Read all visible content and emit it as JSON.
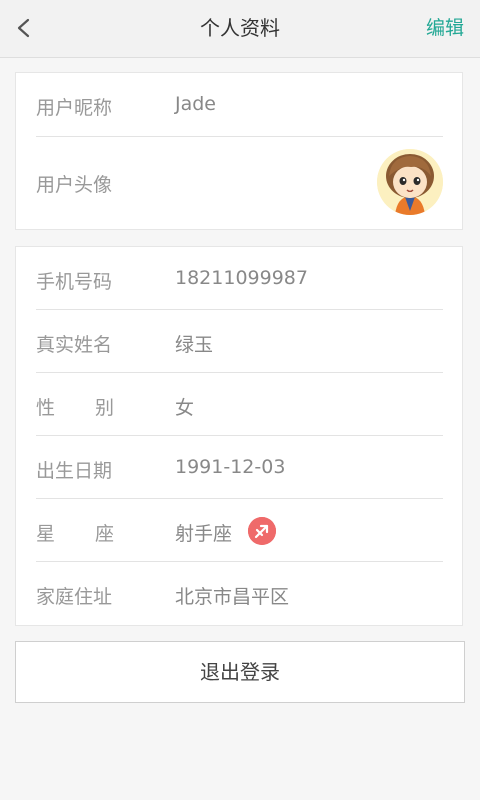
{
  "header": {
    "title": "个人资料",
    "edit_label": "编辑"
  },
  "profile": {
    "nickname_label": "用户昵称",
    "nickname_value": "Jade",
    "avatar_label": "用户头像"
  },
  "details": {
    "phone_label": "手机号码",
    "phone_value": "18211099987",
    "realname_label": "真实姓名",
    "realname_value": "绿玉",
    "gender_label_chars": [
      "性",
      "别"
    ],
    "gender_value": "女",
    "birthday_label": "出生日期",
    "birthday_value": "1991-12-03",
    "zodiac_label_chars": [
      "星",
      "座"
    ],
    "zodiac_value": "射手座",
    "address_label": "家庭住址",
    "address_value": "北京市昌平区"
  },
  "logout_label": "退出登录",
  "colors": {
    "accent": "#23a895",
    "zodiac_badge": "#ef6a6a"
  },
  "icons": {
    "back": "chevron-left-icon",
    "zodiac": "sagittarius-icon",
    "avatar": "avatar-cartoon-girl"
  }
}
